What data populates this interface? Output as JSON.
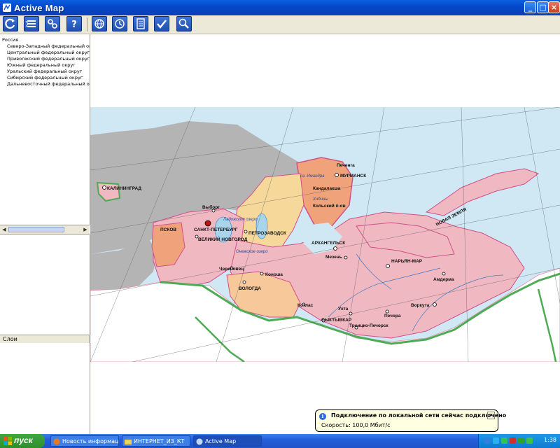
{
  "window": {
    "title": "Active Map"
  },
  "window_buttons": {
    "minimize": "_",
    "maximize": "□",
    "close": "×"
  },
  "toolbar": {
    "buttons": [
      {
        "icon": "refresh-icon"
      },
      {
        "icon": "layers-list-icon"
      },
      {
        "icon": "find-objects-icon"
      },
      {
        "icon": "help-icon"
      },
      {
        "icon": "globe-icon"
      },
      {
        "icon": "clock-icon"
      },
      {
        "icon": "document-icon"
      },
      {
        "icon": "checkmark-icon"
      },
      {
        "icon": "zoom-icon"
      }
    ]
  },
  "tree": {
    "root": "Россия",
    "items": [
      "Северо-Западный федеральный округ",
      "Центральный федеральный округ",
      "Приволжский федеральный округ",
      "Южный федеральный округ",
      "Уральский федеральный округ",
      "Сибирский федеральный округ",
      "Дальневосточный федеральный округ"
    ]
  },
  "layers": {
    "header": "Слои"
  },
  "map": {
    "cities": [
      "Печенга",
      "МУРМАНСК",
      "Кандалакша",
      "Хибины",
      "КАЛИНИНГРАД",
      "Выборг",
      "САНКТ-ПЕТЕРБУРГ",
      "ПСКОВ",
      "ВЕЛИКИЙ НОВГОРОД",
      "ПЕТРОЗАВОДСК",
      "АРХАНГЕЛЬСК",
      "НАРЬЯН-МАР",
      "Амдерма",
      "Череповец",
      "Котлас",
      "Коноша",
      "Мезень",
      "ВОЛОГДА",
      "Ухта",
      "СЫКТЫВКАР",
      "Печора",
      "Воркута",
      "Троицко-Печорск"
    ],
    "water_labels": [
      "Ладожское озеро",
      "Онежское озеро",
      "оз. Имандра",
      "Кольский п-ов"
    ],
    "land_labels": [
      "НОВАЯ ЗЕМЛЯ"
    ]
  },
  "balloon": {
    "title": "Подключение по локальной сети сейчас подключено",
    "body": "Скорость: 100,0 Мбит/с"
  },
  "taskbar": {
    "start_label": "пуск",
    "tasks": [
      {
        "label": "Новость информации"
      },
      {
        "label": "ИНТЕРНЕТ_ИЗ_КТ"
      },
      {
        "label": "Active Map"
      }
    ],
    "clock": "1:38"
  },
  "colors": {
    "title_bar": "#0248c8",
    "sea": "#cfe8f4",
    "foreign_land": "#b4b4b4",
    "region_pink": "#f0b8c0",
    "region_salmon": "#f0a37a",
    "region_yellow": "#f6d89a",
    "border_green": "#4faa55"
  }
}
